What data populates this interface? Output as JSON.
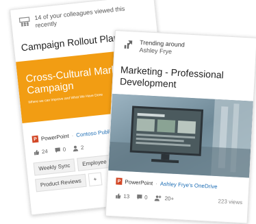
{
  "back_card": {
    "colleagues_text": "14 of your colleagues viewed this recently",
    "title": "Campaign Rollout Plans",
    "thumb_title": "Cross-Cultural Marketing Campaign",
    "thumb_subtitle": "Where we can Improve and What We Have Done",
    "app": "PowerPoint",
    "location": "Contoso Public F",
    "likes": "24",
    "comments": "0",
    "viewers": "2",
    "tags": [
      "Weekly Sync",
      "Employee H",
      "Product Reviews",
      "+"
    ],
    "colors": {
      "thumb_bg": "#f29d13"
    }
  },
  "front_card": {
    "trending_label": "Trending around",
    "trending_user": "Ashley Frye",
    "title": "Marketing - Professional Development",
    "app": "PowerPoint",
    "location": "Ashley Frye's OneDrive",
    "likes": "13",
    "comments": "0",
    "viewers": "20+",
    "views": "223 views"
  }
}
